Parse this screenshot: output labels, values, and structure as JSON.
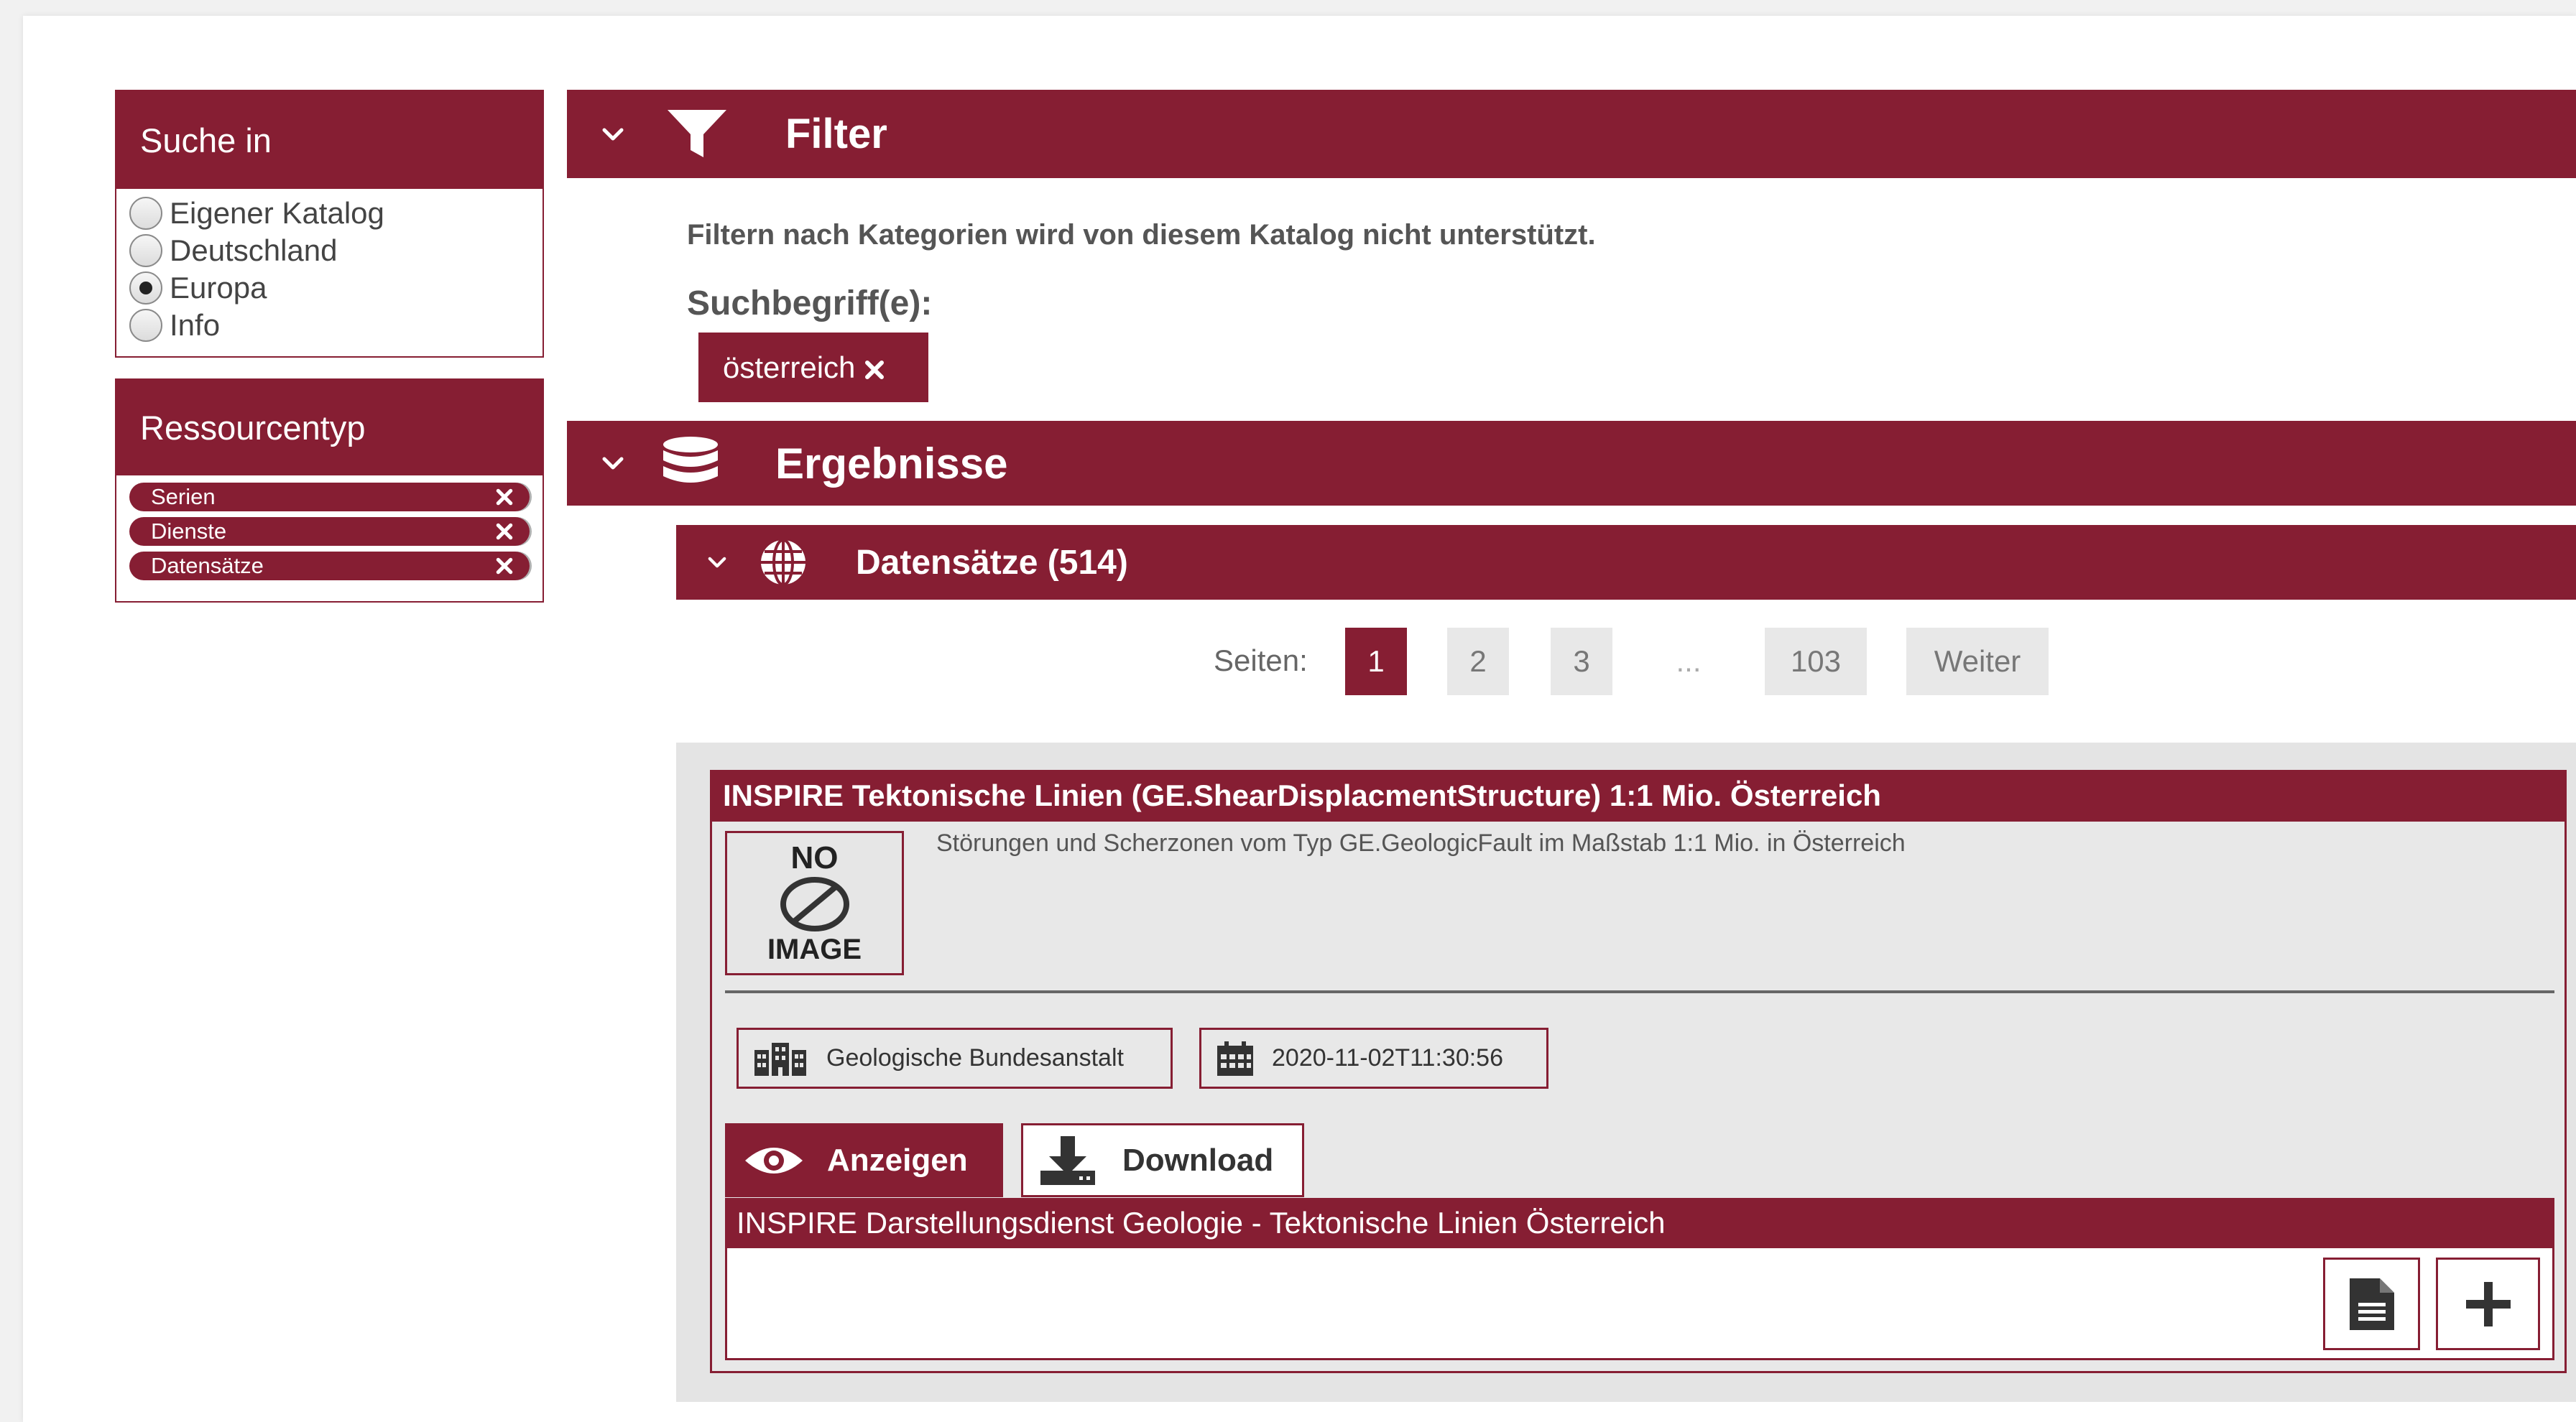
{
  "sidebar": {
    "suche_title": "Suche in",
    "suche_options": [
      {
        "label": "Eigener Katalog",
        "selected": false
      },
      {
        "label": "Deutschland",
        "selected": false
      },
      {
        "label": "Europa",
        "selected": true
      },
      {
        "label": "Info",
        "selected": false
      }
    ],
    "ressource_title": "Ressourcentyp",
    "ressource_tags": [
      "Serien",
      "Dienste",
      "Datensätze"
    ]
  },
  "filter": {
    "title": "Filter",
    "note": "Filtern nach Kategorien wird von diesem Katalog nicht unterstützt.",
    "search_label": "Suchbegriff(e):",
    "search_term": "österreich"
  },
  "results": {
    "title": "Ergebnisse",
    "datasets_title": "Datensätze (514)"
  },
  "pagination": {
    "label": "Seiten:",
    "pages": [
      "1",
      "2",
      "3",
      "...",
      "103"
    ],
    "next": "Weiter",
    "active": "1"
  },
  "record": {
    "title": "INSPIRE Tektonische Linien (GE.ShearDisplacmentStructure) 1:1 Mio. Österreich",
    "thumb_top": "NO",
    "thumb_bottom": "IMAGE",
    "description": "Störungen und Scherzonen vom Typ GE.GeologicFault im Maßstab 1:1 Mio. in Österreich",
    "organization": "Geologische Bundesanstalt",
    "date": "2020-11-02T11:30:56",
    "view_label": "Anzeigen",
    "download_label": "Download",
    "service_title": "INSPIRE Darstellungsdienst Geologie - Tektonische Linien Österreich"
  },
  "colors": {
    "accent": "#861e33",
    "panel": "#e8e8e8",
    "text": "#444444"
  }
}
